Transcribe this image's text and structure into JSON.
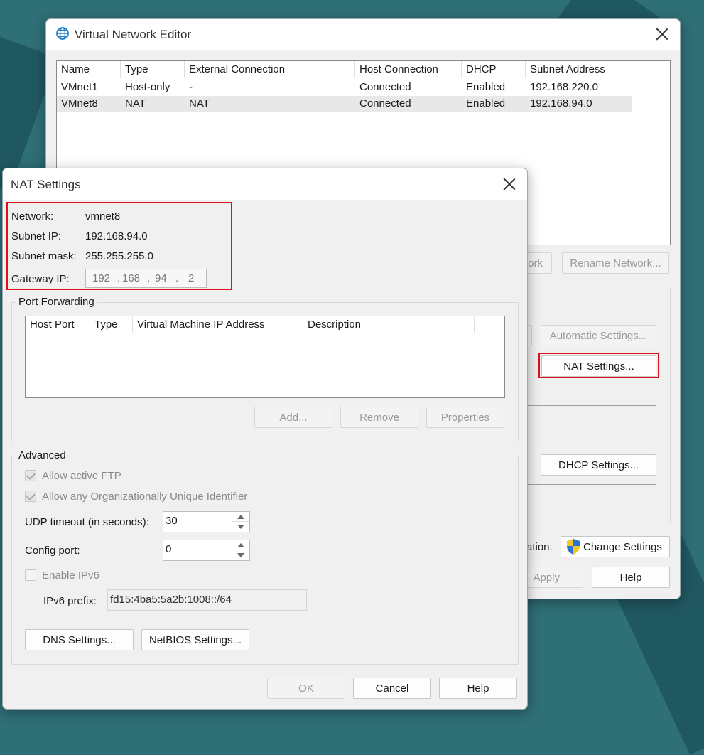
{
  "vne": {
    "title": "Virtual Network Editor",
    "columns": [
      "Name",
      "Type",
      "External Connection",
      "Host Connection",
      "DHCP",
      "Subnet Address"
    ],
    "rows": [
      [
        "VMnet1",
        "Host-only",
        "-",
        "Connected",
        "Enabled",
        "192.168.220.0"
      ],
      [
        "VMnet8",
        "NAT",
        "NAT",
        "Connected",
        "Enabled",
        "192.168.94.0"
      ]
    ],
    "remove_network_partial": "ork",
    "rename_network": "Rename Network...",
    "automatic_settings": "Automatic Settings...",
    "nat_settings": "NAT Settings...",
    "dhcp_settings": "DHCP Settings...",
    "info_partial": "ation.",
    "change_settings": "Change Settings",
    "apply": "Apply",
    "help": "Help"
  },
  "nat": {
    "title": "NAT Settings",
    "network_label": "Network:",
    "network_value": "vmnet8",
    "subnet_ip_label": "Subnet IP:",
    "subnet_ip_value": "192.168.94.0",
    "subnet_mask_label": "Subnet mask:",
    "subnet_mask_value": "255.255.255.0",
    "gateway_label": "Gateway IP:",
    "gateway_octets": [
      "192",
      "168",
      "94",
      "2"
    ],
    "port_forwarding": {
      "title": "Port Forwarding",
      "columns": [
        "Host Port",
        "Type",
        "Virtual Machine IP Address",
        "Description"
      ],
      "add": "Add...",
      "remove": "Remove",
      "properties": "Properties"
    },
    "advanced": {
      "title": "Advanced",
      "allow_ftp": "Allow active FTP",
      "allow_oui": "Allow any Organizationally Unique Identifier",
      "udp_timeout_label": "UDP timeout (in seconds):",
      "udp_timeout_value": "30",
      "config_port_label": "Config port:",
      "config_port_value": "0",
      "enable_ipv6": "Enable IPv6",
      "ipv6_prefix_label": "IPv6 prefix:",
      "ipv6_prefix_value": "fd15:4ba5:5a2b:1008::/64",
      "dns_settings": "DNS Settings...",
      "netbios_settings": "NetBIOS Settings..."
    },
    "ok": "OK",
    "cancel": "Cancel",
    "help": "Help"
  },
  "colors": {
    "highlight": "#e0101a",
    "selected_row": "#e8e8e8"
  }
}
